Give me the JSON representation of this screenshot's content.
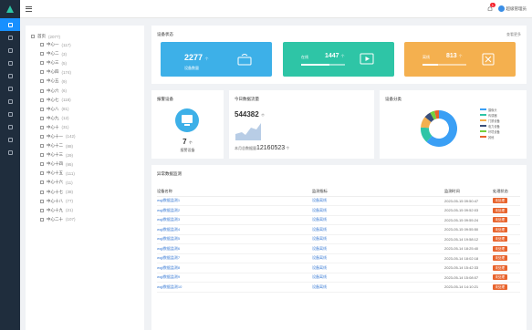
{
  "topbar": {
    "notif_count": "1",
    "username": "超级管理员"
  },
  "tree": {
    "root": {
      "label": "首页",
      "count": "(2077)"
    },
    "items": [
      {
        "label": "中心一",
        "count": "(117)"
      },
      {
        "label": "中心二",
        "count": "(3)"
      },
      {
        "label": "中心三",
        "count": "(5)"
      },
      {
        "label": "中心四",
        "count": "(174)"
      },
      {
        "label": "中心五",
        "count": "(9)"
      },
      {
        "label": "中心六",
        "count": "(6)"
      },
      {
        "label": "中心七",
        "count": "(118)"
      },
      {
        "label": "中心八",
        "count": "(81)"
      },
      {
        "label": "中心九",
        "count": "(12)"
      },
      {
        "label": "中心十",
        "count": "(31)"
      },
      {
        "label": "中心十一",
        "count": "(142)"
      },
      {
        "label": "中心十二",
        "count": "(88)"
      },
      {
        "label": "中心十三",
        "count": "(29)"
      },
      {
        "label": "中心十四",
        "count": "(95)"
      },
      {
        "label": "中心十五",
        "count": "(111)"
      },
      {
        "label": "中心十六",
        "count": "(11)"
      },
      {
        "label": "中心十七",
        "count": "(38)"
      },
      {
        "label": "中心十八",
        "count": "(77)"
      },
      {
        "label": "中心十九",
        "count": "(21)"
      },
      {
        "label": "中心二十",
        "count": "(107)"
      }
    ]
  },
  "overview": {
    "title": "设备状态",
    "more": "查看更多",
    "cards": [
      {
        "value": "2277",
        "unit": "个",
        "label": "设备数量",
        "color": "#3db0e8"
      },
      {
        "label": "在线",
        "value": "1447",
        "unit": "个",
        "color": "#2ec5a6",
        "progress": 0.64
      },
      {
        "label": "离线",
        "value": "813",
        "unit": "个",
        "color": "#f4b04f",
        "progress": 0.36
      }
    ]
  },
  "alarm": {
    "title": "报警设备",
    "value": "7",
    "unit": "个",
    "label": "报警设备"
  },
  "traffic": {
    "title": "今日数据流量",
    "value": "544382",
    "unit": "个",
    "sub_label": "本月总数据量",
    "sub_value": "12160523",
    "sub_unit": "个"
  },
  "category": {
    "title": "设备分类",
    "chart_data": {
      "type": "pie",
      "series": [
        {
          "name": "摄像头",
          "value": 62,
          "color": "#3a9ff5"
        },
        {
          "name": "传感器",
          "value": 14,
          "color": "#2ec5a6"
        },
        {
          "name": "门禁设备",
          "value": 10,
          "color": "#f4b04f"
        },
        {
          "name": "电力设备",
          "value": 6,
          "color": "#3b4f7a"
        },
        {
          "name": "环境设备",
          "value": 4,
          "color": "#73d13d"
        },
        {
          "name": "其他",
          "value": 4,
          "color": "#e8632c"
        }
      ]
    }
  },
  "table": {
    "title": "异常数据监测",
    "headers": [
      "设备名称",
      "监测指标",
      "监测时间",
      "处理状态"
    ],
    "rows": [
      {
        "name": "wqjl数据监测1",
        "metric": "设备离线",
        "time": "2023-05-15 09:50:47",
        "status": "未处理"
      },
      {
        "name": "wqjl数据监测2",
        "metric": "设备离线",
        "time": "2023-05-15 09:52:03",
        "status": "未处理"
      },
      {
        "name": "wqjl数据监测3",
        "metric": "设备离线",
        "time": "2023-05-15 09:55:24",
        "status": "未处理"
      },
      {
        "name": "wqjl数据监测4",
        "metric": "设备离线",
        "time": "2023-05-15 09:55:50",
        "status": "未处理"
      },
      {
        "name": "wqjl数据监测5",
        "metric": "设备离线",
        "time": "2023-05-14 19:58:12",
        "status": "未处理"
      },
      {
        "name": "wqjl数据监测6",
        "metric": "设备离线",
        "time": "2023-05-14 18:25:40",
        "status": "未处理"
      },
      {
        "name": "wqjl数据监测7",
        "metric": "设备离线",
        "time": "2023-05-14 18:02:18",
        "status": "未处理"
      },
      {
        "name": "wqjl数据监测8",
        "metric": "设备离线",
        "time": "2023-05-14 15:42:33",
        "status": "未处理"
      },
      {
        "name": "wqjl数据监测9",
        "metric": "设备离线",
        "time": "2023-05-14 15:08:07",
        "status": "未处理"
      },
      {
        "name": "wqjl数据监测10",
        "metric": "设备离线",
        "time": "2023-05-14 14:10:21",
        "status": "未处理"
      }
    ]
  }
}
